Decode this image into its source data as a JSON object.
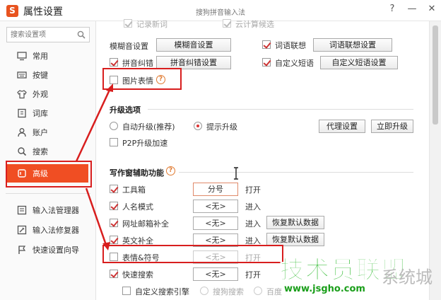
{
  "titlebar": {
    "app_title": "属性设置",
    "logo_glyph": "S",
    "center_title": "搜狗拼音输入法",
    "help": "?",
    "minimize": "—",
    "close": "✕"
  },
  "sidebar": {
    "search_placeholder": "搜索设置项",
    "items": [
      {
        "label": "常用",
        "icon": "monitor-icon"
      },
      {
        "label": "按键",
        "icon": "keyboard-icon"
      },
      {
        "label": "外观",
        "icon": "shirt-icon"
      },
      {
        "label": "词库",
        "icon": "book-icon"
      },
      {
        "label": "账户",
        "icon": "user-icon"
      },
      {
        "label": "搜索",
        "icon": "search-icon"
      },
      {
        "label": "高级",
        "icon": "advanced-icon",
        "active": true
      }
    ],
    "tools": [
      {
        "label": "输入法管理器",
        "icon": "manager-icon"
      },
      {
        "label": "输入法修复器",
        "icon": "repair-icon"
      },
      {
        "label": "快速设置向导",
        "icon": "flag-icon"
      }
    ]
  },
  "content": {
    "top_partial_left": "记录新词",
    "top_partial_right": "云计算候选",
    "fuzzy": {
      "label": "模糊音设置",
      "button": "模糊音设置"
    },
    "assoc": {
      "label": "词语联想",
      "button": "词语联想设置"
    },
    "correct": {
      "label": "拼音纠错",
      "button": "拼音纠错设置"
    },
    "custom_phrase": {
      "label": "自定义短语",
      "button": "自定义短语设置"
    },
    "picture_emoji": {
      "label": "图片表情"
    },
    "upgrade": {
      "title": "升级选项",
      "auto": "自动升级(推荐)",
      "prompt": "提示升级",
      "proxy_button": "代理设置",
      "upgrade_button": "立即升级",
      "p2p": "P2P升级加速"
    },
    "assist": {
      "title": "写作窗辅助功能",
      "rows": [
        {
          "label": "工具箱",
          "value": "分号",
          "action": "打开",
          "reset": ""
        },
        {
          "label": "人名模式",
          "value": "<无>",
          "action": "进入",
          "reset": ""
        },
        {
          "label": "网址邮箱补全",
          "value": "<无>",
          "action": "进入",
          "reset": "恢复默认数据"
        },
        {
          "label": "英文补全",
          "value": "<无>",
          "action": "进入",
          "reset": "恢复默认数据"
        },
        {
          "label": "表情&符号",
          "value": "<无>",
          "action": "打开",
          "reset": ""
        },
        {
          "label": "快速搜索",
          "value": "<无>",
          "action": "打开",
          "reset": ""
        }
      ],
      "custom_engine": "自定义搜索引擎",
      "engine_sogou": "搜狗搜索",
      "engine_baidu": "百度"
    }
  },
  "watermark": {
    "main": "技术员联盟",
    "url": "www.jsgho.com",
    "grey": "系统城"
  },
  "colors": {
    "accent": "#f04e23",
    "annotation": "#d81e1e",
    "watermark": "#1db41d"
  }
}
